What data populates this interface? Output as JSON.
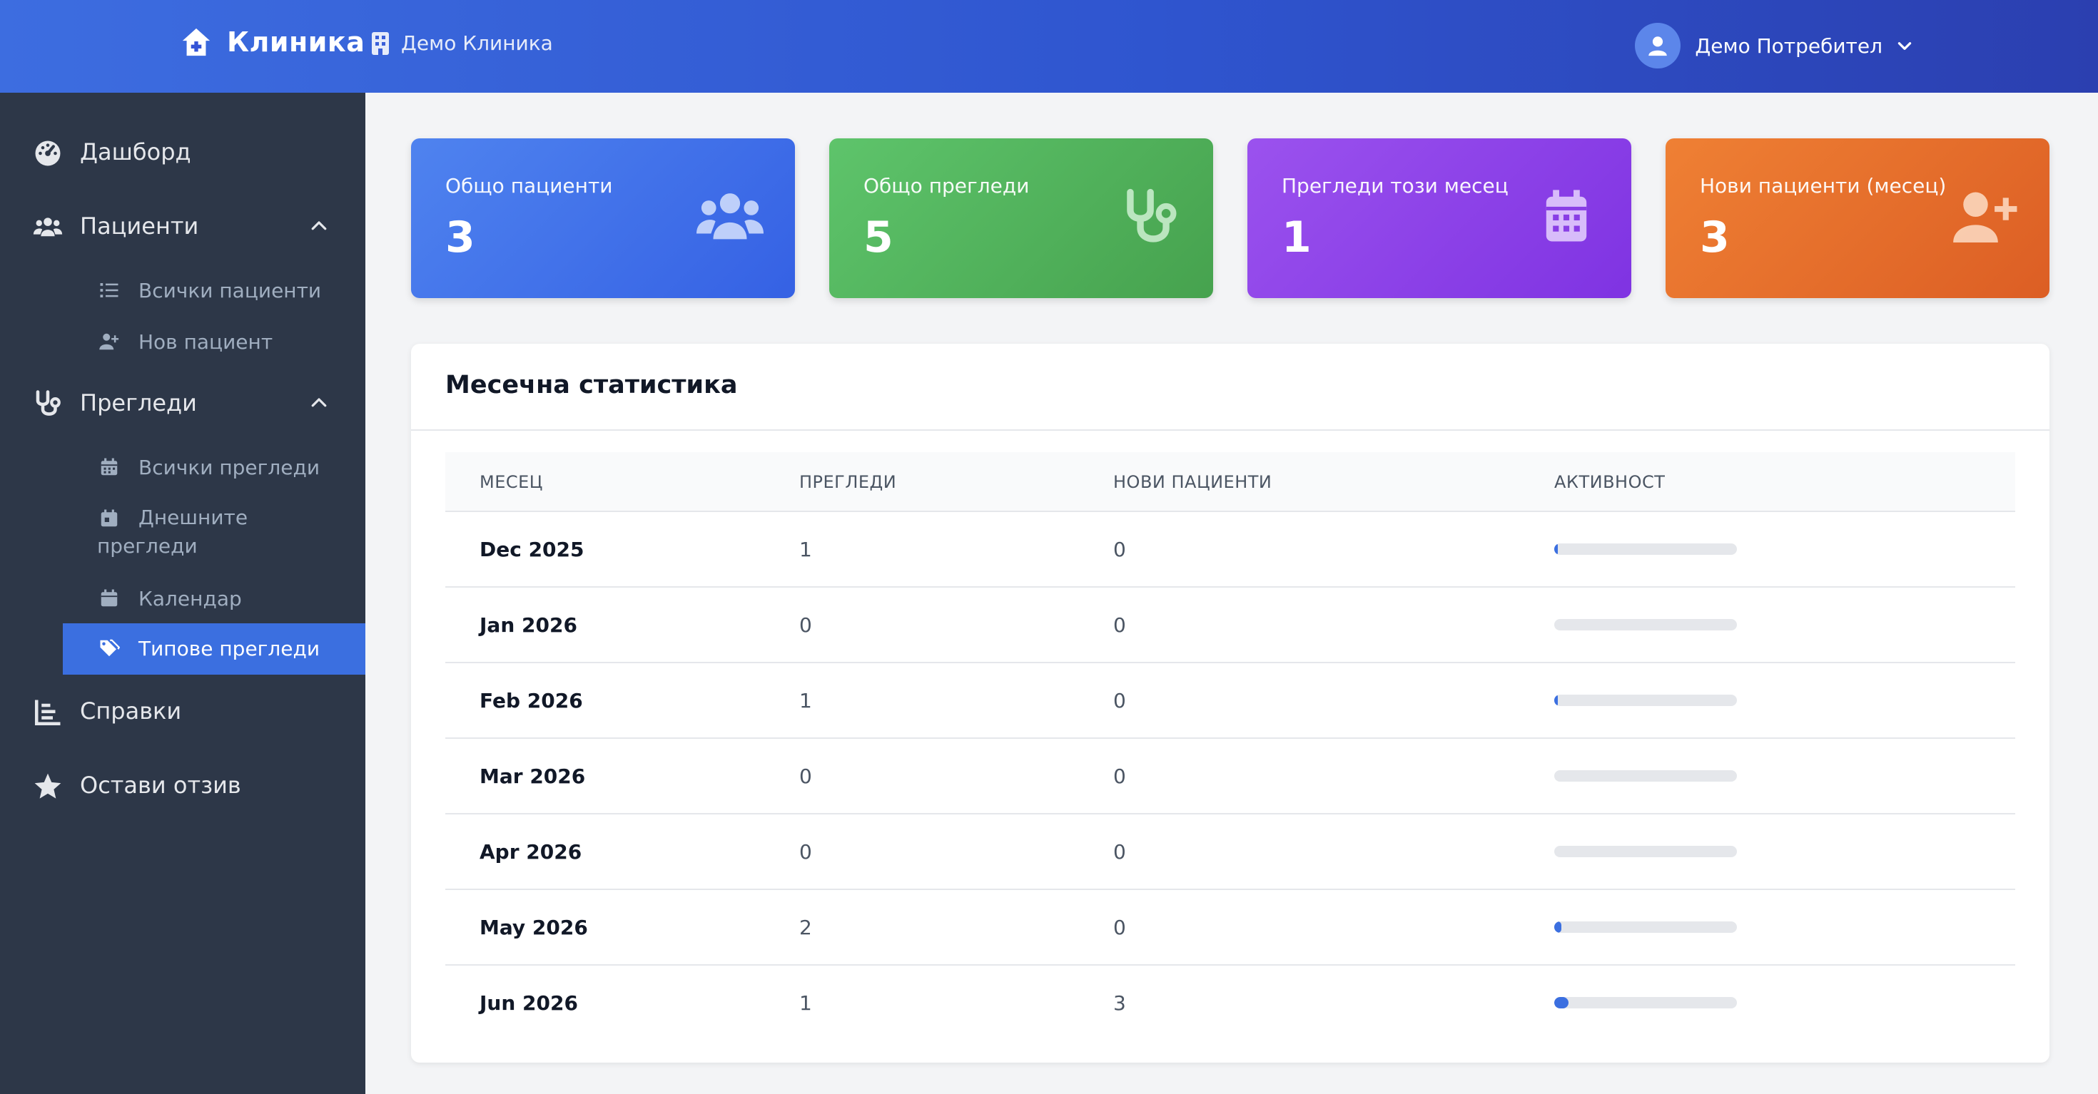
{
  "header": {
    "brand": "Клиника",
    "clinic_name": "Демо Клиника",
    "user_name": "Демо Потребител"
  },
  "sidebar": {
    "dashboard": "Дашборд",
    "patients": "Пациенти",
    "patients_items": [
      "Всички пациенти",
      "Нов пациент"
    ],
    "exams": "Прегледи",
    "exams_items": [
      "Всички прегледи",
      "Днешните прегледи",
      "Календар",
      "Типове прегледи"
    ],
    "active_item": "Типове прегледи",
    "reports": "Справки",
    "feedback": "Остави отзив"
  },
  "stats": [
    {
      "title": "Общо пациенти",
      "value": "3",
      "icon": "users-icon",
      "color": "#3d6de0"
    },
    {
      "title": "Общо прегледи",
      "value": "5",
      "icon": "stethoscope-icon",
      "color": "#4caf50"
    },
    {
      "title": "Прегледи този месец",
      "value": "1",
      "icon": "calendar-icon",
      "color": "#8b3fe8"
    },
    {
      "title": "Нови пациенти (месец)",
      "value": "3",
      "icon": "user-plus-icon",
      "color": "#e36a2a"
    }
  ],
  "monthly": {
    "title": "Месечна статистика",
    "columns": [
      "МЕСЕЦ",
      "ПРЕГЛЕДИ",
      "НОВИ ПАЦИЕНТИ",
      "АКТИВНОСТ"
    ],
    "rows": [
      {
        "month": "Dec 2025",
        "exams": "1",
        "new_patients": "0",
        "activity": 0.02
      },
      {
        "month": "Jan 2026",
        "exams": "0",
        "new_patients": "0",
        "activity": 0
      },
      {
        "month": "Feb 2026",
        "exams": "1",
        "new_patients": "0",
        "activity": 0.02
      },
      {
        "month": "Mar 2026",
        "exams": "0",
        "new_patients": "0",
        "activity": 0
      },
      {
        "month": "Apr 2026",
        "exams": "0",
        "new_patients": "0",
        "activity": 0
      },
      {
        "month": "May 2026",
        "exams": "2",
        "new_patients": "0",
        "activity": 0.04
      },
      {
        "month": "Jun 2026",
        "exams": "1",
        "new_patients": "3",
        "activity": 0.08
      }
    ]
  },
  "colors": {
    "accent": "#3b6fe0",
    "sidebar_bg": "#2d3748",
    "topbar": "#2f55cf"
  }
}
